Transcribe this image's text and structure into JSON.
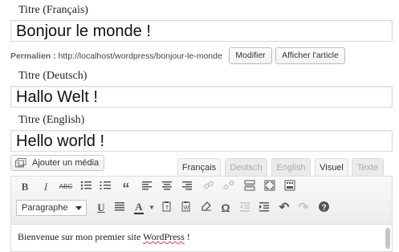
{
  "titles": [
    {
      "label": "Titre (Français)",
      "value": "Bonjour le monde !"
    },
    {
      "label": "Titre (Deutsch)",
      "value": "Hallo Welt !"
    },
    {
      "label": "Titre (English)",
      "value": "Hello world !"
    }
  ],
  "permalink": {
    "label": "Permalien :",
    "url": "http://localhost/wordpress/bonjour-le-monde",
    "modify_label": "Modifier",
    "view_label": "Afficher l'article"
  },
  "media": {
    "add_label": "Ajouter un média"
  },
  "tabs": [
    {
      "label": "Français",
      "active": true
    },
    {
      "label": "Deutsch",
      "active": false
    },
    {
      "label": "English",
      "active": false
    },
    {
      "label": "Visuel",
      "active": true
    },
    {
      "label": "Texte",
      "active": false
    }
  ],
  "toolbar": {
    "row1": [
      "bold-icon",
      "italic-icon",
      "strikethrough-icon",
      "bullet-list-icon",
      "numbered-list-icon",
      "blockquote-icon",
      "align-left-icon",
      "align-center-icon",
      "align-right-icon",
      "link-icon",
      "unlink-icon",
      "read-more-icon",
      "fullscreen-icon",
      "kitchen-sink-icon"
    ],
    "row2": [
      "underline-icon",
      "justify-icon",
      "text-color-icon",
      "paste-text-icon",
      "paste-word-icon",
      "clear-format-icon",
      "special-char-icon",
      "outdent-icon",
      "indent-icon",
      "undo-icon",
      "redo-icon",
      "help-icon"
    ],
    "format_select": "Paragraphe"
  },
  "editor": {
    "text_before": "Bienvenue sur mon premier site ",
    "text_misspelled": "WordPress",
    "text_after": " !"
  }
}
